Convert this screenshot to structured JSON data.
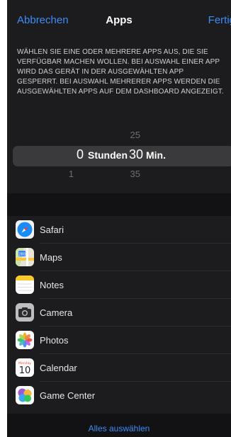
{
  "nav": {
    "cancel": "Abbrechen",
    "title": "Apps",
    "done": "Fertig"
  },
  "description": "WÄHLEN SIE EINE ODER MEHRERE APPS AUS, DIE SIE VERFÜGBAR MACHEN WOLLEN. BEI AUSWAHL EINER APP WIRD DAS GERÄT IN DER AUSGEWÄHLTEN APP GESPERRT. BEI AUSWAHL MEHRERER APPS WERDEN DIE AUSGEWÄHLTEN APPS AUF DEM DASHBOARD ANGEZEIGT.",
  "picker": {
    "minutes_above": "25",
    "hours_selected": "0",
    "hours_unit": "Stunden",
    "minutes_selected": "30",
    "minutes_unit": "Min.",
    "hours_below": "1",
    "minutes_below": "35"
  },
  "apps": [
    {
      "label": "Safari",
      "icon": "safari-icon"
    },
    {
      "label": "Maps",
      "icon": "maps-icon"
    },
    {
      "label": "Notes",
      "icon": "notes-icon"
    },
    {
      "label": "Camera",
      "icon": "camera-icon"
    },
    {
      "label": "Photos",
      "icon": "photos-icon"
    },
    {
      "label": "Calendar",
      "icon": "calendar-icon",
      "icon_day": "Monday",
      "icon_date": "10"
    },
    {
      "label": "Game Center",
      "icon": "game-center-icon"
    }
  ],
  "select_all": "Alles auswählen",
  "colors": {
    "accent": "#3a8df7",
    "background": "#1c1c1e"
  }
}
